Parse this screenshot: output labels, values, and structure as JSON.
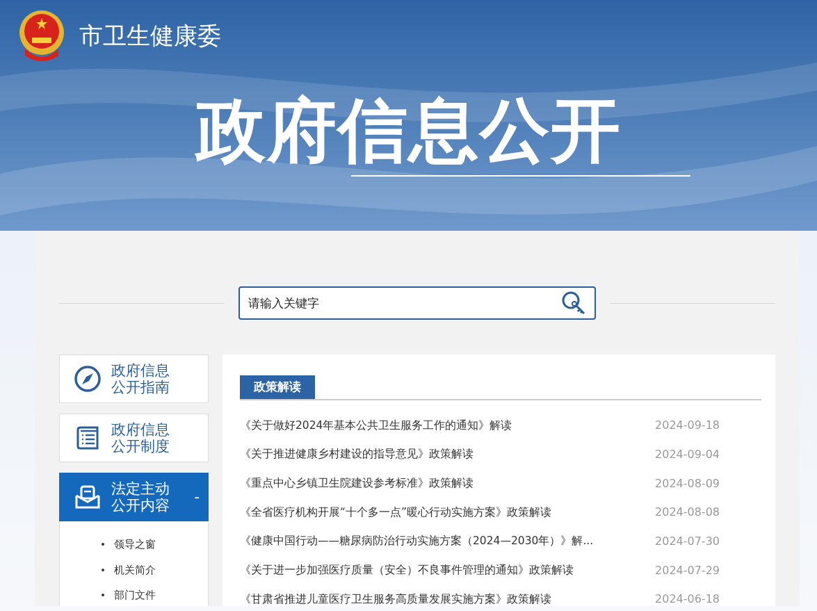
{
  "header": {
    "site_title": "市卫生健康委",
    "banner_title": "政府信息公开"
  },
  "search": {
    "placeholder": "请输入关键字"
  },
  "sidebar": {
    "items": [
      {
        "kind": "guide",
        "label": "政府信息公开指南",
        "expanded": false
      },
      {
        "kind": "system",
        "label": "政府信息公开制度",
        "expanded": false
      },
      {
        "kind": "content",
        "label": "法定主动公开内容",
        "expanded": true,
        "toggle": "-",
        "children": [
          {
            "label": "领导之窗"
          },
          {
            "label": "机关简介"
          },
          {
            "label": "部门文件"
          }
        ]
      }
    ]
  },
  "news": {
    "tab": "政策解读",
    "items": [
      {
        "title": "《关于做好2024年基本公共卫生服务工作的通知》解读",
        "date": "2024-09-18"
      },
      {
        "title": "《关于推进健康乡村建设的指导意见》政策解读",
        "date": "2024-09-04"
      },
      {
        "title": "《重点中心乡镇卫生院建设参考标准》政策解读",
        "date": "2024-08-09"
      },
      {
        "title": "《全省医疗机构开展“十个多一点”暖心行动实施方案》政策解读",
        "date": "2024-08-08"
      },
      {
        "title": "《健康中国行动——糖尿病防治行动实施方案（2024—2030年）》解...",
        "date": "2024-07-30"
      },
      {
        "title": "《关于进一步加强医疗质量（安全）不良事件管理的通知》政策解读",
        "date": "2024-07-29"
      },
      {
        "title": "《甘肃省推进儿童医疗卫生服务高质量发展实施方案》政策解读",
        "date": "2024-06-18"
      }
    ]
  }
}
